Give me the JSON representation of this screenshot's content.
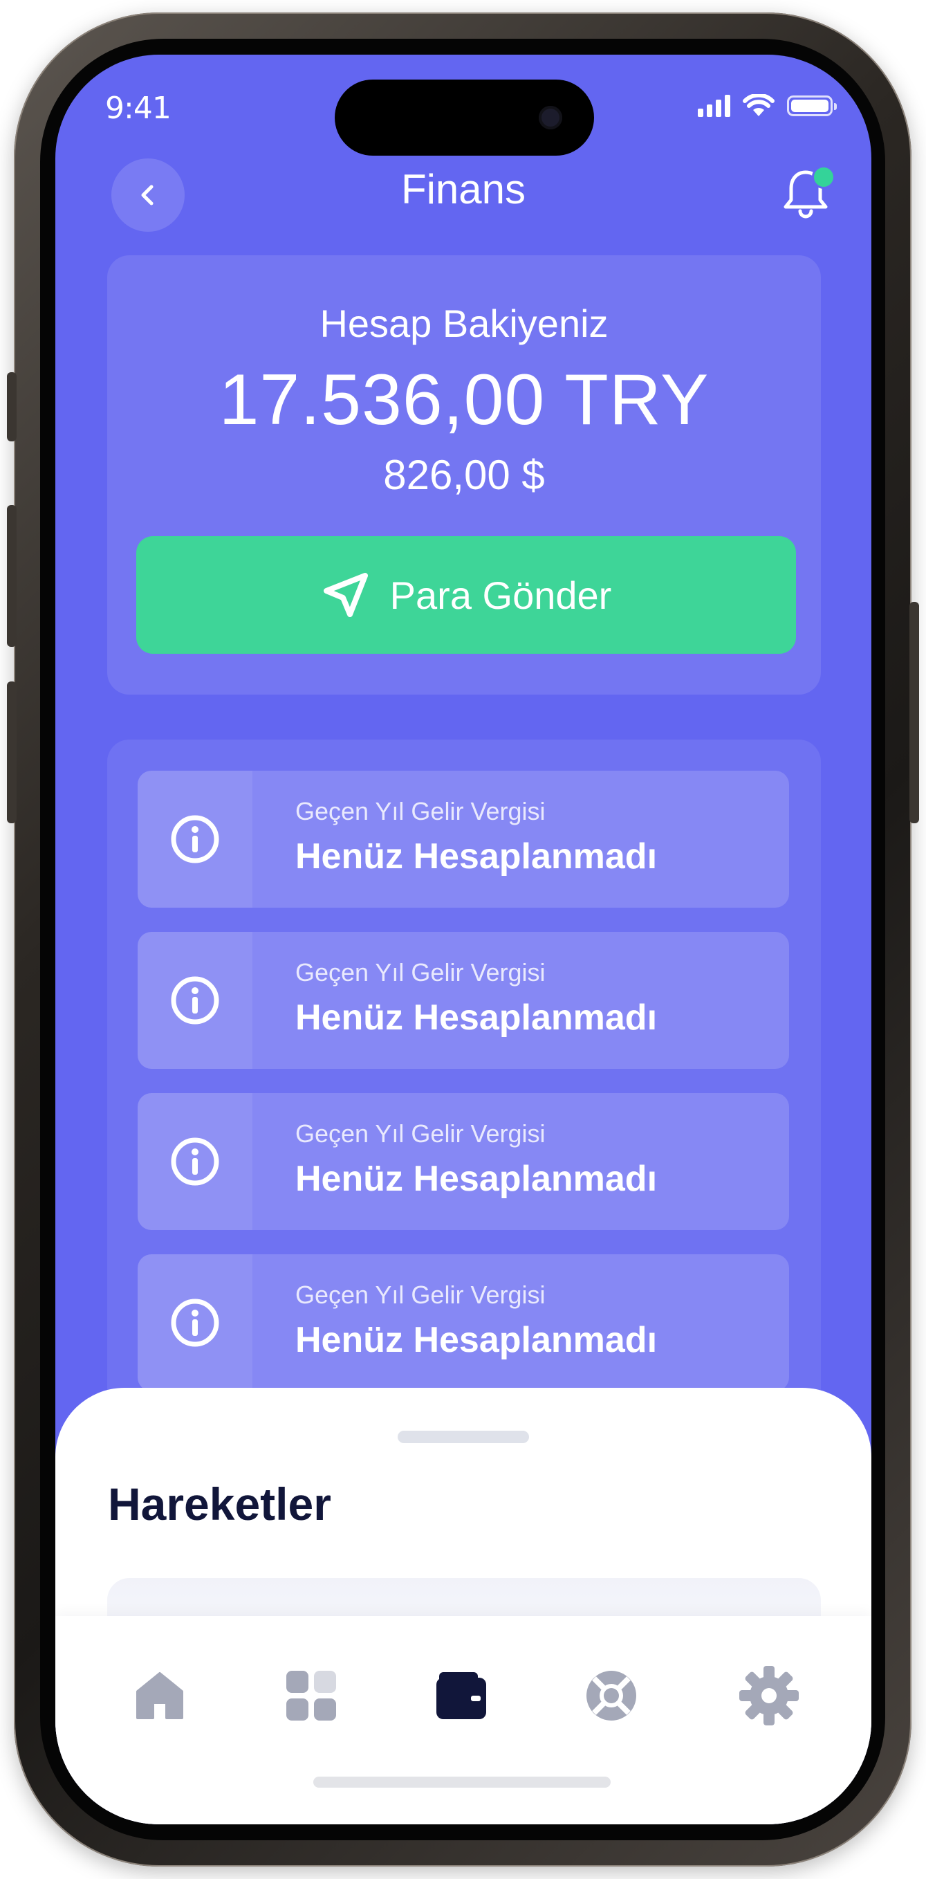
{
  "status_bar": {
    "time": "9:41"
  },
  "header": {
    "title": "Finans",
    "back_icon": "chevron-left-icon",
    "notification_icon": "bell-icon"
  },
  "balance": {
    "label": "Hesap Bakiyeniz",
    "amount": "17.536,00 TRY",
    "usd_amount": "826,00 $",
    "send_button_label": "Para Gönder",
    "send_icon": "send-icon"
  },
  "info_items": [
    {
      "subtitle": "Geçen Yıl Gelir Vergisi",
      "title": "Henüz Hesaplanmadı",
      "icon": "info-icon"
    },
    {
      "subtitle": "Geçen Yıl Gelir Vergisi",
      "title": "Henüz Hesaplanmadı",
      "icon": "info-icon"
    },
    {
      "subtitle": "Geçen Yıl Gelir Vergisi",
      "title": "Henüz Hesaplanmadı",
      "icon": "info-icon"
    },
    {
      "subtitle": "Geçen Yıl Gelir Vergisi",
      "title": "Henüz Hesaplanmadı",
      "icon": "info-icon"
    }
  ],
  "sheet": {
    "title": "Hareketler"
  },
  "tabbar": {
    "items": [
      {
        "icon": "home-icon",
        "active": false
      },
      {
        "icon": "grid-icon",
        "active": false
      },
      {
        "icon": "wallet-icon",
        "active": true
      },
      {
        "icon": "lifebuoy-icon",
        "active": false
      },
      {
        "icon": "gear-icon",
        "active": false
      }
    ]
  },
  "colors": {
    "primary": "#6366f1",
    "accent_green": "#3ed598",
    "dark_navy": "#11163a",
    "inactive_icon": "#a4a8b8"
  }
}
